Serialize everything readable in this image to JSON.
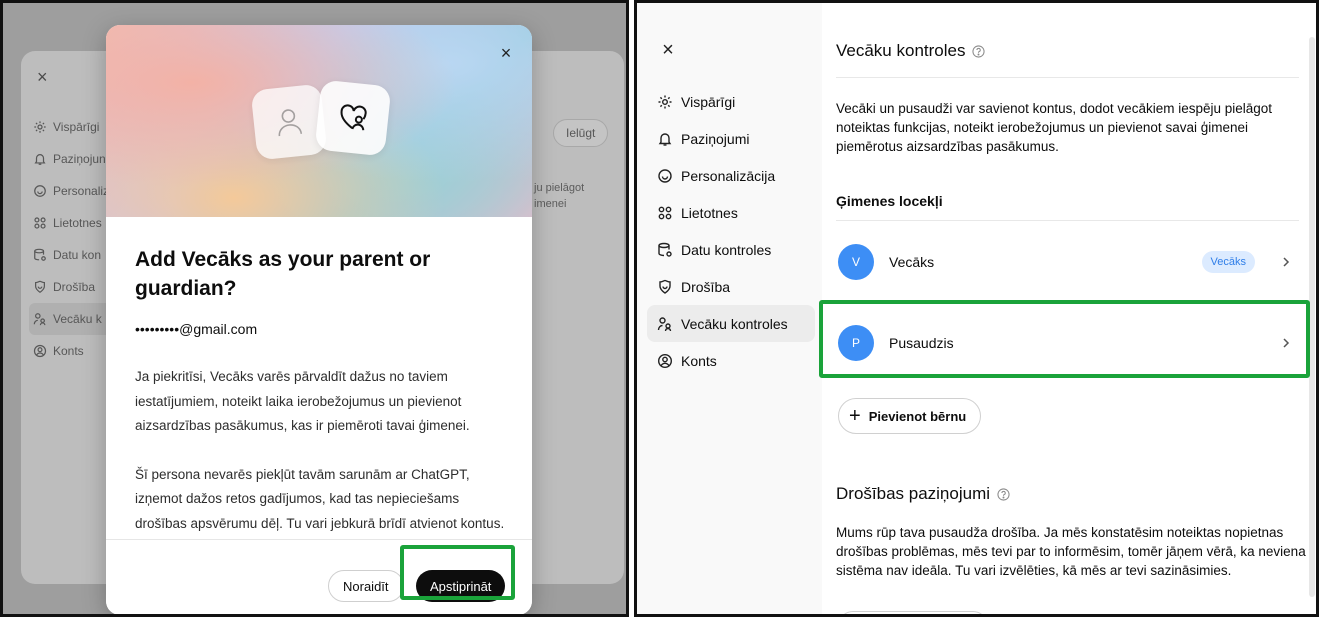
{
  "left": {
    "background": {
      "close": "×",
      "menu": [
        {
          "icon": "gear-icon",
          "label": "Vispārīgi"
        },
        {
          "icon": "bell-icon",
          "label": "Paziņojun"
        },
        {
          "icon": "palette-icon",
          "label": "Personaliz"
        },
        {
          "icon": "apps-icon",
          "label": "Lietotnes"
        },
        {
          "icon": "database-icon",
          "label": "Datu kon"
        },
        {
          "icon": "shield-icon",
          "label": "Drošība"
        },
        {
          "icon": "family-icon",
          "label": "Vecāku k"
        },
        {
          "icon": "user-circle-icon",
          "label": "Konts"
        }
      ],
      "invite_button": "Ielūgt",
      "text_lines": [
        "ju pielāgot",
        "imenei"
      ]
    },
    "modal": {
      "close": "×",
      "title": "Add Vecāks as your parent or guardian?",
      "email": "•••••••••@gmail.com",
      "paragraph1": "Ja piekritīsi, Vecāks varēs pārvaldīt dažus no taviem iestatījumiem, noteikt laika ierobežojumus un pievienot aizsardzības pasākumus, kas ir piemēroti tavai ģimenei.",
      "paragraph2": "Šī persona nevarēs piekļūt tavām sarunām ar ChatGPT, izņemot dažos retos gadījumos, kad tas nepieciešams drošības apsvērumu dēļ. Tu vari jebkurā brīdī atvienot kontus. Uzzināt vairāk",
      "reject": "Noraidīt",
      "confirm": "Apstiprināt"
    }
  },
  "right": {
    "close": "×",
    "menu": [
      {
        "icon": "gear-icon",
        "label": "Vispārīgi"
      },
      {
        "icon": "bell-icon",
        "label": "Paziņojumi"
      },
      {
        "icon": "palette-icon",
        "label": "Personalizācija"
      },
      {
        "icon": "apps-icon",
        "label": "Lietotnes"
      },
      {
        "icon": "database-icon",
        "label": "Datu kontroles"
      },
      {
        "icon": "shield-icon",
        "label": "Drošība"
      },
      {
        "icon": "family-icon",
        "label": "Vecāku kontroles"
      },
      {
        "icon": "user-circle-icon",
        "label": "Konts"
      }
    ],
    "active_menu_index": 6,
    "title": "Vecāku kontroles",
    "intro": "Vecāki un pusaudži var savienot kontus, dodot vecākiem iespēju pielāgot noteiktas funkcijas, noteikt ierobežojumus un pievienot savai ģimenei piemērotus aizsardzības pasākumus.",
    "family_title": "Ģimenes locekļi",
    "members": [
      {
        "initial": "V",
        "name": "Vecāks",
        "badge": "Vecāks"
      },
      {
        "initial": "P",
        "name": "Pusaudzis",
        "badge": ""
      }
    ],
    "add_child": "Pievienot bērnu",
    "safety_title": "Drošības paziņojumi",
    "safety_text": "Mums rūp tava pusaudža drošība. Ja mēs konstatēsim noteiktas nopietnas drošības problēmas, mēs tevi par to informēsim, tomēr jāņem vērā, ka neviena sistēma nav ideāla. Tu vari izvēlēties, kā mēs ar tevi sazināsimies."
  },
  "colors": {
    "highlight": "#1aa33a",
    "avatar": "#3d8ef5",
    "badge_bg": "#dcebff",
    "badge_text": "#2f7ee8",
    "confirm_bg": "#0d0d0d"
  }
}
